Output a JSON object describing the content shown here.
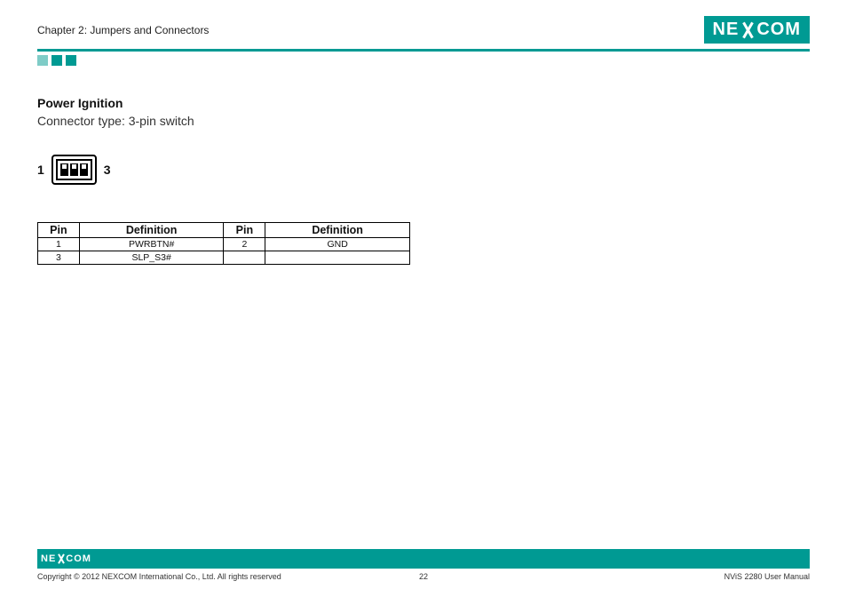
{
  "header": {
    "chapter": "Chapter 2: Jumpers and Connectors",
    "logo_left": "NE",
    "logo_right": "COM"
  },
  "section": {
    "title": "Power Ignition",
    "subtitle": "Connector type: 3-pin switch"
  },
  "connector": {
    "left_label": "1",
    "right_label": "3"
  },
  "table": {
    "headers": {
      "pin": "Pin",
      "def": "Definition"
    },
    "rows": [
      {
        "pin_a": "1",
        "def_a": "PWRBTN#",
        "pin_b": "2",
        "def_b": "GND"
      },
      {
        "pin_a": "3",
        "def_a": "SLP_S3#",
        "pin_b": "",
        "def_b": ""
      }
    ]
  },
  "footer": {
    "copyright": "Copyright © 2012 NEXCOM International Co., Ltd. All rights reserved",
    "page": "22",
    "doc": "NViS 2280 User Manual",
    "logo_left": "NE",
    "logo_right": "COM"
  }
}
